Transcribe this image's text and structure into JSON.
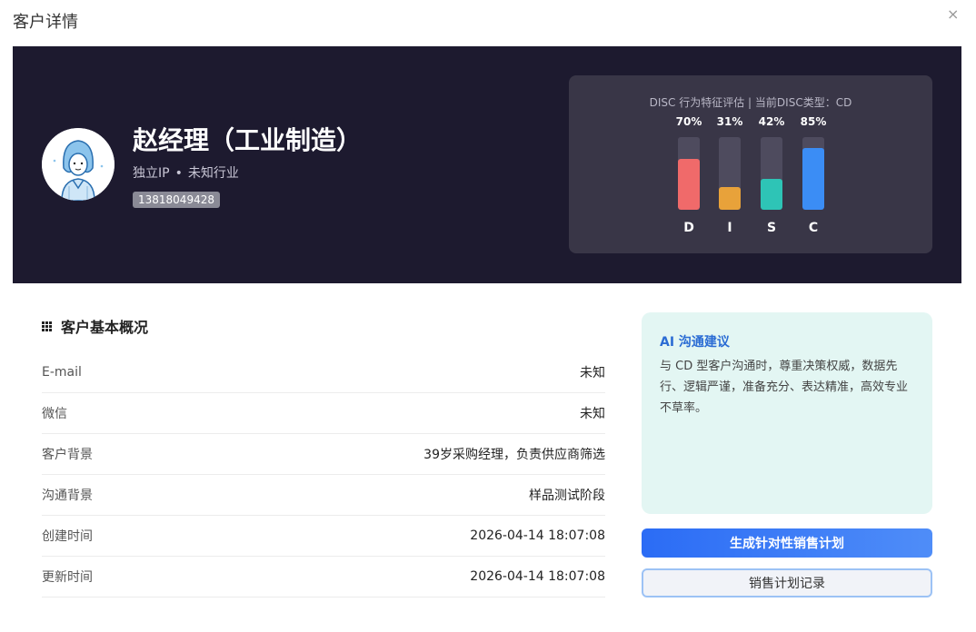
{
  "dialog": {
    "title": "客户详情",
    "close_icon": "×"
  },
  "customer": {
    "name": "赵经理（工业制造）",
    "ip_type": "独立IP",
    "separator": "•",
    "industry": "未知行业",
    "phone": "13818049428"
  },
  "disc": {
    "caption": "DISC 行为特征评估 | 当前DISC类型：CD",
    "items": [
      {
        "letter": "D",
        "percent": "70%",
        "value": 0.7,
        "color": "#f06a6a"
      },
      {
        "letter": "I",
        "percent": "31%",
        "value": 0.31,
        "color": "#e8a23a"
      },
      {
        "letter": "S",
        "percent": "42%",
        "value": 0.42,
        "color": "#2ec4b6"
      },
      {
        "letter": "C",
        "percent": "85%",
        "value": 0.85,
        "color": "#3b8df5"
      }
    ]
  },
  "overview": {
    "title": "客户基本概况",
    "rows": [
      {
        "label": "E-mail",
        "value": "未知"
      },
      {
        "label": "微信",
        "value": "未知"
      },
      {
        "label": "客户背景",
        "value": "39岁采购经理，负责供应商筛选"
      },
      {
        "label": "沟通背景",
        "value": "样品测试阶段"
      },
      {
        "label": "创建时间",
        "value": "2026-04-14 18:07:08"
      },
      {
        "label": "更新时间",
        "value": "2026-04-14 18:07:08"
      }
    ]
  },
  "ai": {
    "title": "AI 沟通建议",
    "text": "与 CD 型客户沟通时，尊重决策权威，数据先行、逻辑严谨，准备充分、表达精准，高效专业不草率。"
  },
  "actions": {
    "generate_label": "生成针对性销售计划",
    "records_label": "销售计划记录"
  }
}
